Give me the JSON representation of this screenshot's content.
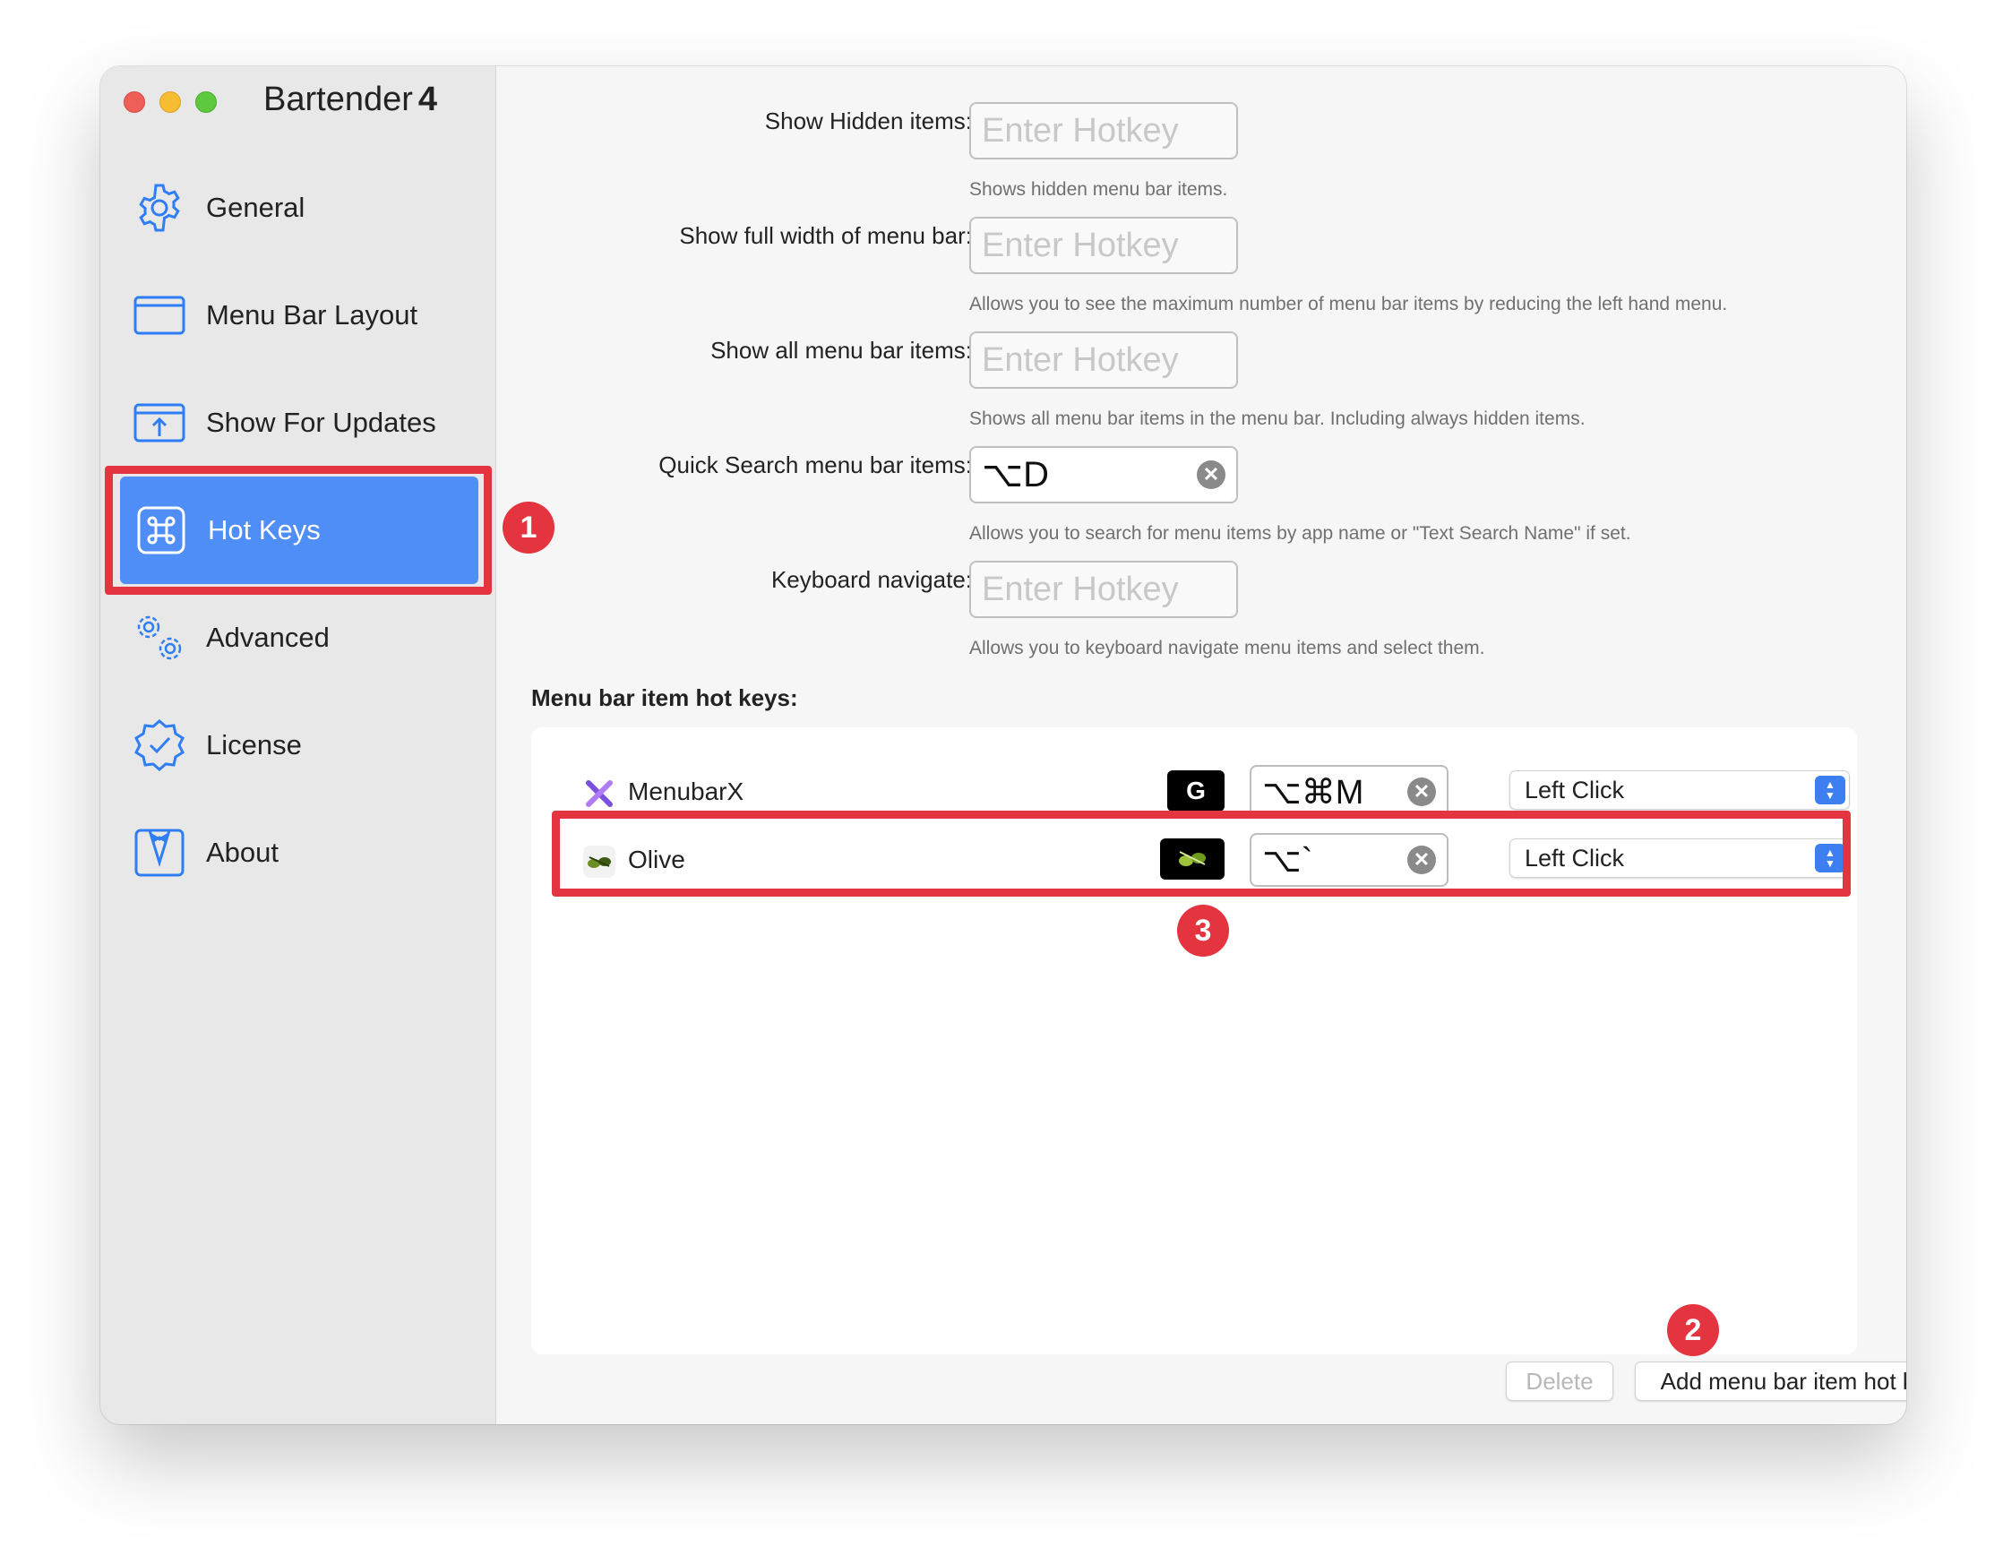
{
  "app": {
    "name": "Bartender",
    "version": "4"
  },
  "sidebar": {
    "items": [
      {
        "label": "General",
        "icon": "gear-icon"
      },
      {
        "label": "Menu Bar Layout",
        "icon": "window-icon"
      },
      {
        "label": "Show For Updates",
        "icon": "upload-box-icon"
      },
      {
        "label": "Hot Keys",
        "icon": "command-key-icon",
        "active": true
      },
      {
        "label": "Advanced",
        "icon": "gears-icon"
      },
      {
        "label": "License",
        "icon": "verified-badge-icon"
      },
      {
        "label": "About",
        "icon": "tuxedo-icon"
      }
    ]
  },
  "settings": {
    "rows": [
      {
        "label": "Show Hidden items:",
        "value": "",
        "placeholder": "Enter Hotkey",
        "hint": "Shows hidden menu bar items."
      },
      {
        "label": "Show full width of menu bar:",
        "value": "",
        "placeholder": "Enter Hotkey",
        "hint": "Allows you to see the maximum number of menu bar items by reducing the left hand menu."
      },
      {
        "label": "Show all menu bar items:",
        "value": "",
        "placeholder": "Enter Hotkey",
        "hint": "Shows all menu bar items in the menu bar. Including always hidden items."
      },
      {
        "label": "Quick Search menu bar items:",
        "value": "⌥D",
        "placeholder": "",
        "hint": "Allows you to search for menu items by app name or \"Text Search Name\" if set."
      },
      {
        "label": "Keyboard navigate:",
        "value": "",
        "placeholder": "Enter Hotkey",
        "hint": "Allows you to keyboard navigate menu items and select them."
      }
    ]
  },
  "item_hotkeys": {
    "title": "Menu bar item hot keys:",
    "rows": [
      {
        "app": "MenubarX",
        "mini_icon": "G",
        "hotkey": "⌥⌘M",
        "action": "Left Click"
      },
      {
        "app": "Olive",
        "mini_icon": "",
        "hotkey": "⌥`",
        "action": "Left Click"
      }
    ],
    "delete_label": "Delete",
    "add_label": "Add menu bar item hot key"
  },
  "annotations": {
    "one": "1",
    "two": "2",
    "three": "3"
  },
  "colors": {
    "accent": "#4f8ef7",
    "annotation": "#e4343f",
    "icon_blue": "#2f7ef5"
  }
}
